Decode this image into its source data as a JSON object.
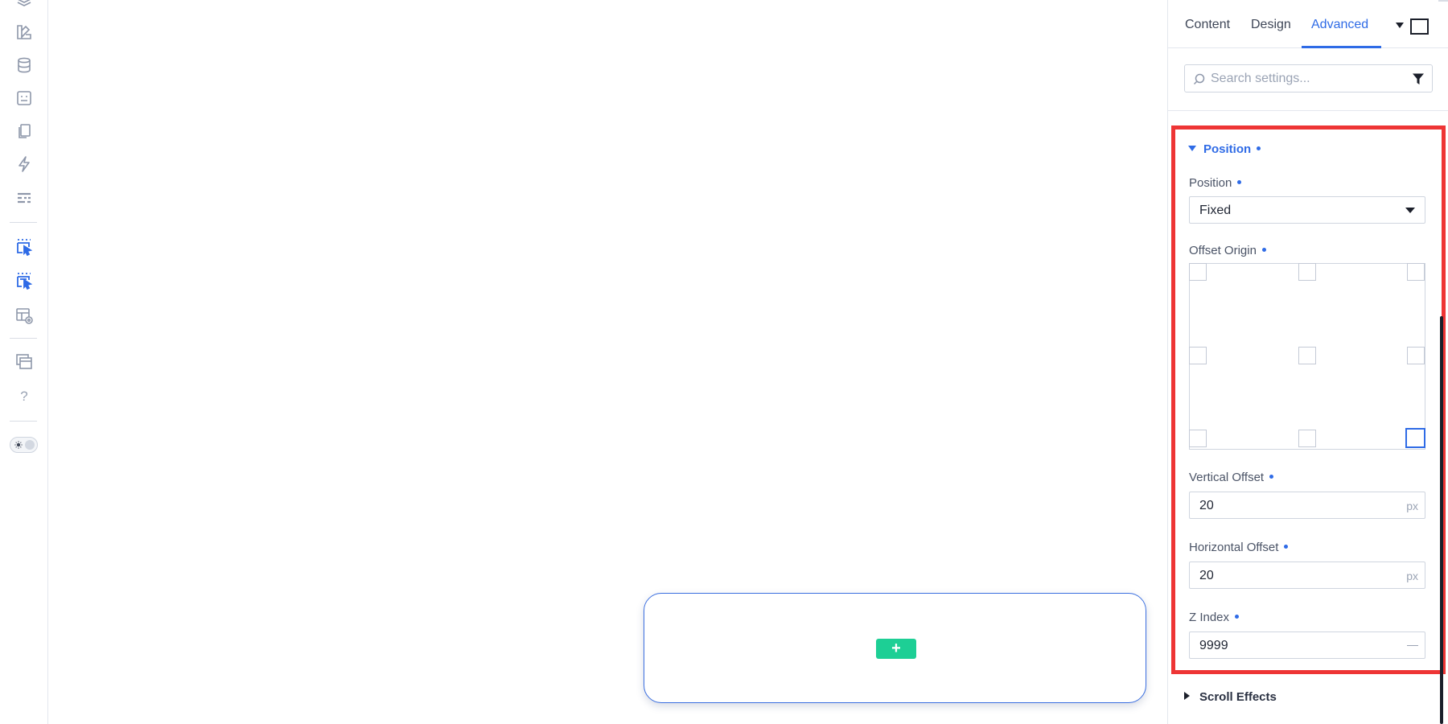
{
  "rail": {
    "icons": [
      "layers-icon",
      "theme-builder-icon",
      "database-icon",
      "portability-icon",
      "pages-icon",
      "bolt-icon",
      "layout-icon",
      "select-element-icon",
      "select-multiple-icon",
      "preview-layout-icon",
      "windows-icon"
    ],
    "help_label": "?",
    "toggle": "dark-mode-toggle"
  },
  "canvas": {
    "add_label": "+"
  },
  "panel": {
    "tabs": [
      {
        "label": "Content"
      },
      {
        "label": "Design"
      },
      {
        "label": "Advanced"
      }
    ],
    "active_tab": "Advanced",
    "search": {
      "placeholder": "Search settings...",
      "value": ""
    },
    "position_section": {
      "title": "Position",
      "position_label": "Position",
      "position_value": "Fixed",
      "offset_origin_label": "Offset Origin",
      "offset_origin_selected": "bottom-right",
      "vertical_offset_label": "Vertical Offset",
      "vertical_offset_value": "20",
      "vertical_offset_unit": "px",
      "horizontal_offset_label": "Horizontal Offset",
      "horizontal_offset_value": "20",
      "horizontal_offset_unit": "px",
      "z_index_label": "Z Index",
      "z_index_value": "9999"
    },
    "scroll_effects_label": "Scroll Effects"
  },
  "colors": {
    "accent": "#2f6be6",
    "highlight": "#ee3535",
    "add_button": "#1dcf95"
  }
}
